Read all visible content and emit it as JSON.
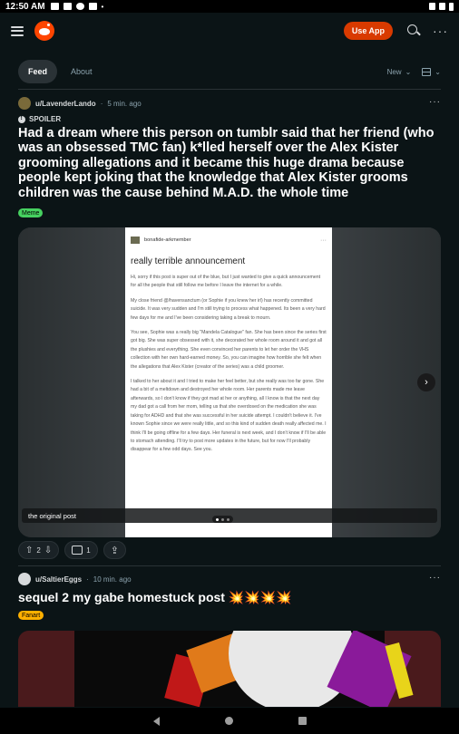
{
  "status_bar": {
    "time": "12:50 AM"
  },
  "header": {
    "use_app_label": "Use App"
  },
  "tabs": [
    {
      "label": "Feed",
      "active": true
    },
    {
      "label": "About",
      "active": false
    }
  ],
  "sort": {
    "label": "New"
  },
  "post1": {
    "user": "u/LavenderLando",
    "time": "5 min. ago",
    "spoiler_label": "SPOILER",
    "title": "Had a dream where this person on tumblr said that her friend (who was an obsessed TMC fan) k*lled herself over the Alex Kister grooming allegations and it became this huge drama because people kept joking that the knowledge that Alex Kister grooms children was the cause behind M.A.D. the whole time",
    "flair": "Meme",
    "flair_color": "#46d160",
    "votes": "2",
    "comments": "1",
    "gallery": {
      "caption": "the original post",
      "tumblr_user": "bonafide-arkmember",
      "tumblr_title": "really terrible announcement",
      "paragraphs": [
        "Hi, sorry if this post is super out of the blue, but I just wanted to give a quick announcement for all the people that still follow me before I leave the internet for a while.",
        "My close friend @/havensanctum (or Sophie if you knew her irl) has recently committed suicide. It was very sudden and I'm still trying to process what happened. Its been a very hard few days for me and I've been considering taking a break to mourn.",
        "You see, Sophie was a really big \"Mandela Catalogue\" fan. She has been since the series first got big. She was super obsessed with it, she decorated her whole room around it and got all the plushies and everything. She even convinced her parents to let her order the VHS collection with her own hard-earned money. So, you can imagine how horrible she felt when the allegations that Alex Kister (creator of the series) was a child groomer.",
        "I talked to her about it and I tried to make her feel better, but she really was too far gone. She had a bit of a meltdown and destroyed her whole room. Her parents made me leave afterwards, so I don't know if they got mad at her or anything, all I know is that the next day my dad got a call from her mom, telling us that she overdosed on the medication she was taking for ADHD and that she was successful in her suicide attempt. I couldn't believe it. I've known Sophie since we were really little, and so this kind of sudden death really affected me. I think I'll be going offline for a few days. Her funeral is next week, and I don't know if I'll be able to stomach attending. I'll try to post more updates in the future, but for now I'll probably disappear for a few odd days. See you."
      ]
    }
  },
  "post2": {
    "user": "u/SaltierEggs",
    "time": "10 min. ago",
    "title": "sequel 2 my gabe homestuck post 💥💥💥💥",
    "flair": "Fanart",
    "flair_color": "#ffb000"
  },
  "icons": {
    "menu": "hamburger-icon",
    "logo": "reddit-logo",
    "search": "search-icon",
    "more": "more-icon",
    "upvote": "arrow-up-icon",
    "downvote": "arrow-down-icon",
    "comment": "comment-icon",
    "share": "share-icon"
  }
}
